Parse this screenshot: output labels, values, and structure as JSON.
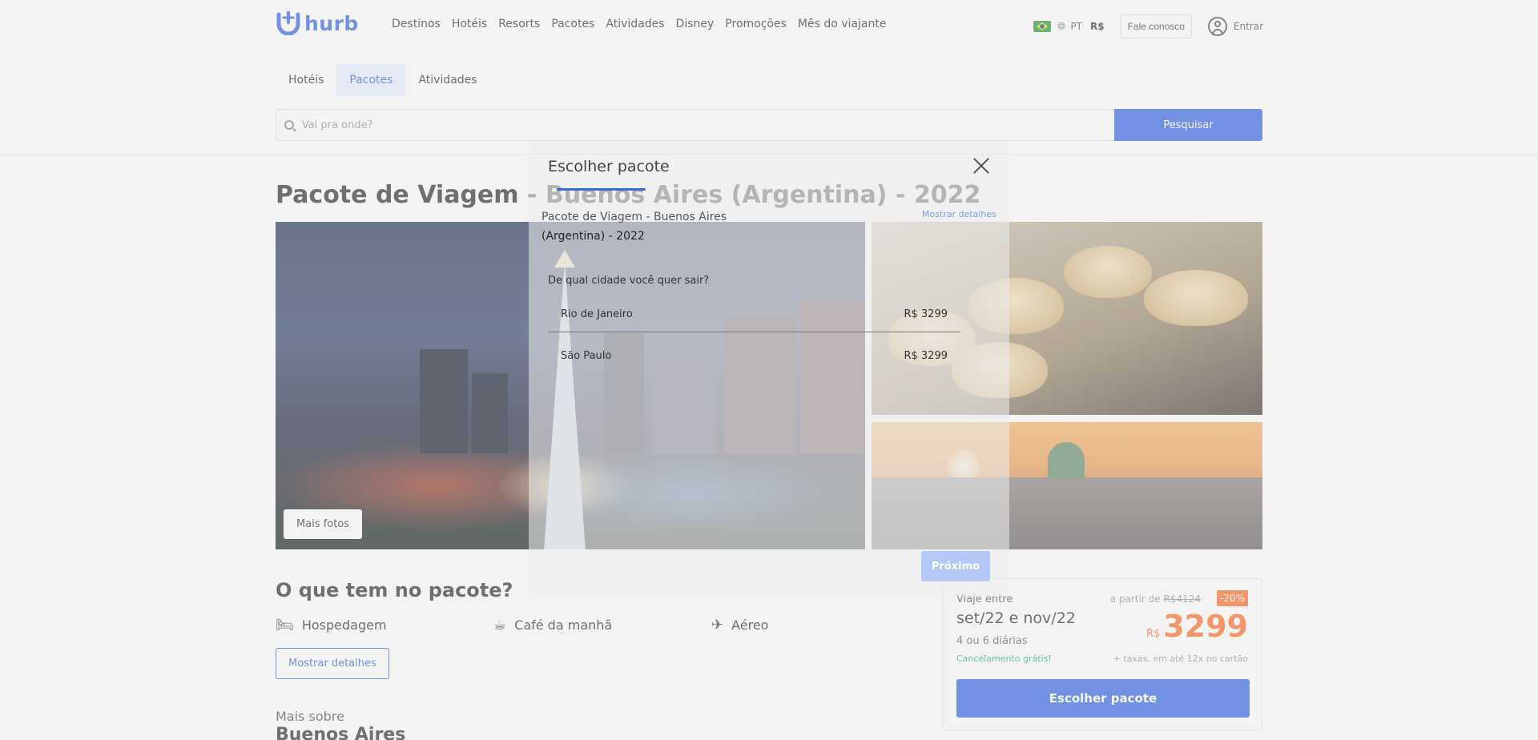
{
  "header": {
    "logo_text": "hurb",
    "nav": [
      "Destinos",
      "Hotéis",
      "Resorts",
      "Pacotes",
      "Atividades",
      "Disney",
      "Promoções",
      "Mês do viajante"
    ],
    "language": "PT",
    "currency": "R$",
    "contact_label": "Fale conosco",
    "login_label": "Entrar"
  },
  "product_tabs": {
    "items": [
      "Hotéis",
      "Pacotes",
      "Atividades"
    ],
    "active": "Pacotes"
  },
  "search": {
    "placeholder": "Vai pra onde?",
    "value": "",
    "button_label": "Pesquisar"
  },
  "page": {
    "title": "Pacote de Viagem - Buenos Aires (Argentina) - 2022",
    "more_photos_label": "Mais fotos",
    "included_title": "O que tem no pacote?",
    "included": [
      {
        "label": "Hospedagem",
        "icon": "bed-icon"
      },
      {
        "label": "Café da manhã",
        "icon": "coffee-icon"
      },
      {
        "label": "Aéreo",
        "icon": "plane-icon"
      }
    ],
    "details_button": "Mostrar detalhes",
    "more_about": "Mais sobre",
    "more_about_city": "Buenos Aires"
  },
  "price_card": {
    "travel_label": "Viaje entre",
    "dates": "set/22 e nov/22",
    "nights": "4 ou 6 diárias",
    "cancellation": "Cancelamento grátis!",
    "from_label": "a partir de",
    "old_price": "R$4124",
    "discount": "-20%",
    "currency": "R$",
    "price": "3299",
    "taxes_note": "+ taxas, em até 12x no cartão",
    "button_label": "Escolher pacote"
  },
  "modal": {
    "title": "Escolher pacote",
    "package_title_line1": "Pacote de Viagem - Buenos Aires",
    "package_title_line2": "(Argentina) - 2022",
    "show_details": "Mostrar detalhes",
    "question": "De qual cidade você quer sair?",
    "options": [
      {
        "city": "Rio de Janeiro",
        "price": "R$ 3299"
      },
      {
        "city": "São Paulo",
        "price": "R$ 3299"
      }
    ],
    "next_label": "Próximo"
  },
  "colors": {
    "brand": "#3a67e8",
    "accent": "#ff6f2b",
    "success": "#2bb673"
  }
}
